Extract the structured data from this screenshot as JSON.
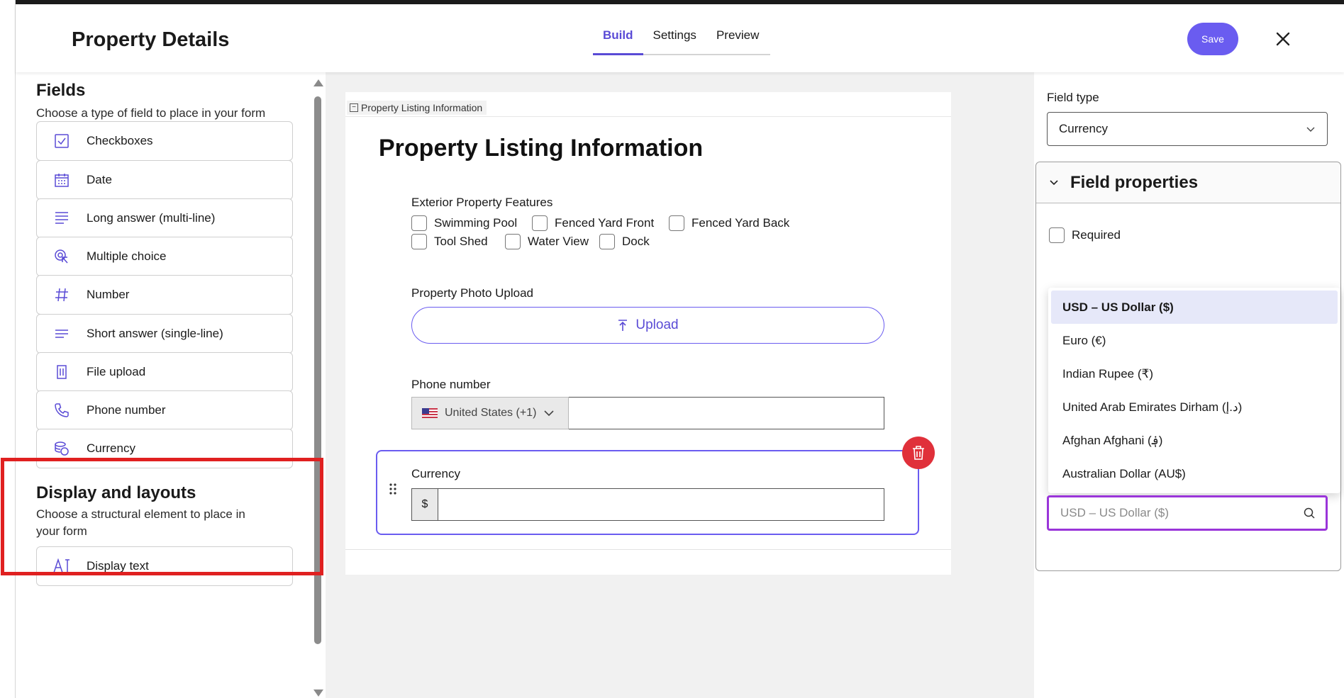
{
  "header": {
    "title": "Property Details",
    "tabs": [
      "Build",
      "Settings",
      "Preview"
    ],
    "active_tab": "Build",
    "save_label": "Save",
    "close_icon": "close-icon"
  },
  "sidebar": {
    "fields_heading": "Fields",
    "fields_sub": "Choose a type of field to place in your form",
    "field_types": [
      {
        "label": "Checkboxes",
        "icon": "checkbox-icon"
      },
      {
        "label": "Date",
        "icon": "calendar-icon"
      },
      {
        "label": "Long answer (multi-line)",
        "icon": "long-text-icon"
      },
      {
        "label": "Multiple choice",
        "icon": "multiple-choice-icon"
      },
      {
        "label": "Number",
        "icon": "hash-icon"
      },
      {
        "label": "Short answer (single-line)",
        "icon": "short-text-icon"
      },
      {
        "label": "File upload",
        "icon": "file-icon"
      },
      {
        "label": "Phone number",
        "icon": "phone-icon"
      },
      {
        "label": "Currency",
        "icon": "coins-icon"
      }
    ],
    "layouts_heading": "Display and layouts",
    "layouts_sub": "Choose a structural element to place in your form",
    "layout_items": [
      {
        "label": "Display text",
        "icon": "text-cursor-icon"
      }
    ]
  },
  "form": {
    "section_tag": "Property Listing Information",
    "title": "Property Listing Information",
    "exterior_label": "Exterior Property Features",
    "exterior_options": [
      "Swimming Pool",
      "Fenced Yard Front",
      "Fenced Yard Back",
      "Tool Shed",
      "Water View",
      "Dock"
    ],
    "photo_label": "Property Photo Upload",
    "upload_label": "Upload",
    "phone_label": "Phone number",
    "phone_country": "United States (+1)",
    "currency_label": "Currency",
    "currency_symbol": "$"
  },
  "right_panel": {
    "field_type_label": "Field type",
    "field_type_value": "Currency",
    "props_heading": "Field properties",
    "required_label": "Required",
    "currency_options": [
      "USD – US Dollar ($)",
      "Euro (€)",
      "Indian Rupee (₹)",
      "United Arab Emirates Dirham (د.إ)",
      "Afghan Afghani (؋)",
      "Australian Dollar (AU$)"
    ],
    "selected_option": "USD – US Dollar ($)",
    "search_placeholder": "USD – US Dollar ($)"
  },
  "colors": {
    "accent": "#6a5cf0",
    "highlight": "#e02020",
    "delete": "#e0303a",
    "search_focus": "#9a35d9"
  }
}
